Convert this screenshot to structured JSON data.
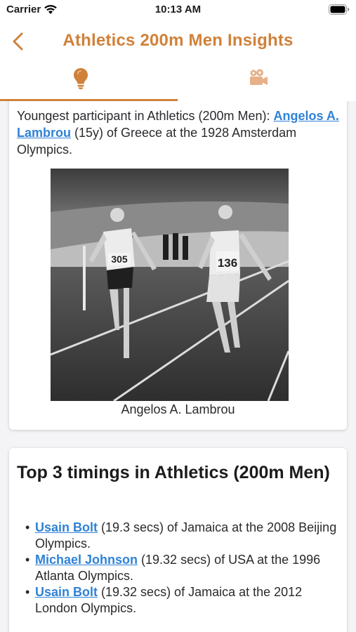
{
  "status_bar": {
    "carrier": "Carrier",
    "time": "10:13 AM"
  },
  "nav": {
    "title": "Athletics 200m Men Insights"
  },
  "tabs": [
    {
      "icon": "lightbulb-icon",
      "selected": true
    },
    {
      "icon": "movie-camera-icon",
      "selected": false
    }
  ],
  "youngest": {
    "text_before": "Youngest participant in Athletics (200m Men): ",
    "athlete": "Angelos A. Lambrou",
    "text_after": " (15y) of Greece at the 1928 Amsterdam Olympics.",
    "caption": "Angelos A. Lambrou"
  },
  "top_timings": {
    "heading": "Top 3 timings in Athletics (200m Men)",
    "bullet": "•",
    "items": [
      {
        "athlete": "Usain Bolt",
        "detail": " (19.3 secs) of Jamaica at the 2008 Beijing Olympics."
      },
      {
        "athlete": "Michael Johnson",
        "detail": " (19.32 secs) of USA at the 1996 Atlanta Olympics."
      },
      {
        "athlete": "Usain Bolt",
        "detail": " (19.32 secs) of Jamaica at the 2012 London Olympics."
      }
    ]
  },
  "colors": {
    "accent": "#d0813a",
    "link": "#2f82d6",
    "background": "#f4f4f6"
  }
}
